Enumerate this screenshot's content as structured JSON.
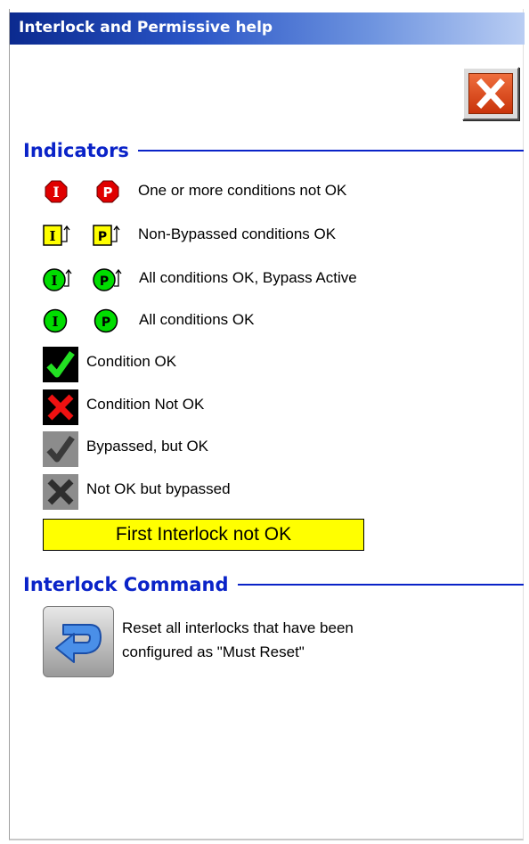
{
  "window": {
    "title": "Interlock and Permissive help"
  },
  "indicators": {
    "heading": "Indicators",
    "interlock_letter": "I",
    "permissive_letter": "P",
    "items": [
      {
        "label": "One or more conditions not OK"
      },
      {
        "label": "Non-Bypassed conditions OK"
      },
      {
        "label": "All conditions OK, Bypass Active"
      },
      {
        "label": "All conditions OK"
      },
      {
        "label": "Condition OK"
      },
      {
        "label": "Condition Not OK"
      },
      {
        "label": "Bypassed, but OK"
      },
      {
        "label": "Not OK but bypassed"
      }
    ],
    "first_interlock_label": "First Interlock not OK"
  },
  "command": {
    "heading": "Interlock Command",
    "reset_line1": "Reset all interlocks that have been",
    "reset_line2": "configured as \"Must Reset\""
  },
  "colors": {
    "heading_blue": "#0a23c8",
    "not_ok_red": "#e00000",
    "ok_green": "#00dd00",
    "yellow": "#ffff00",
    "bypass_gray": "#808080"
  },
  "icons": {
    "close": "close-icon",
    "interlock_not_ok": "interlock-not-ok-icon",
    "permissive_not_ok": "permissive-not-ok-icon",
    "interlock_nonbypassed_ok": "interlock-nonbypassed-ok-icon",
    "permissive_nonbypassed_ok": "permissive-nonbypassed-ok-icon",
    "interlock_bypass_active": "interlock-bypass-active-icon",
    "permissive_bypass_active": "permissive-bypass-active-icon",
    "interlock_ok": "interlock-ok-icon",
    "permissive_ok": "permissive-ok-icon",
    "check": "check-icon",
    "cross": "cross-icon",
    "bypassed_check": "bypassed-check-icon",
    "bypassed_cross": "bypassed-cross-icon",
    "reset": "reset-arrow-icon"
  }
}
